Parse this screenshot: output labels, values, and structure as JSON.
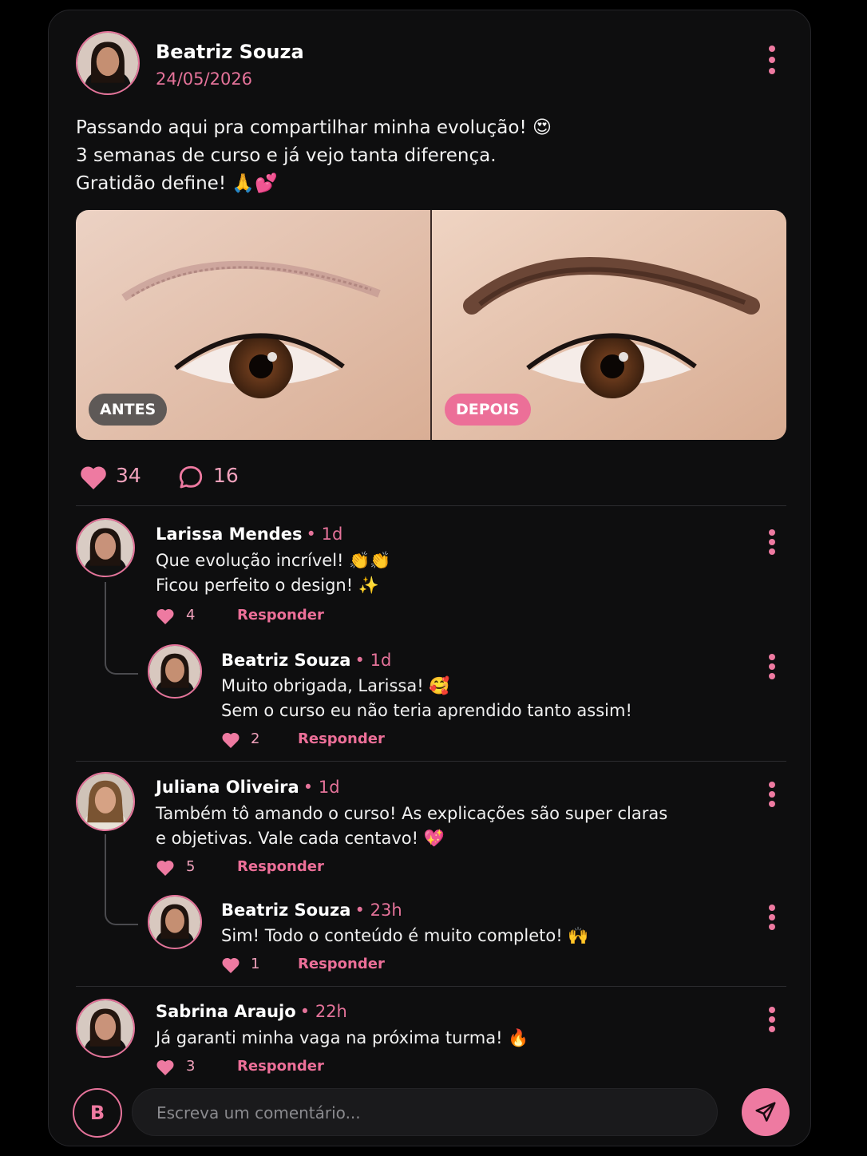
{
  "post": {
    "author": "Beatriz Souza",
    "date": "24/05/2026",
    "lines": [
      "Passando aqui pra compartilhar minha evolução! 😍",
      "3 semanas de curso e já vejo tanta diferença.",
      "Gratidão define! 🙏💕"
    ],
    "before_label": "ANTES",
    "after_label": "DEPOIS",
    "likes": "34",
    "comments": "16"
  },
  "comments": [
    {
      "name": "Larissa Mendes",
      "time": "1d",
      "lines": [
        "Que evolução incrível! 👏👏",
        "Ficou perfeito o design! ✨"
      ],
      "likes": "4",
      "reply_label": "Responder"
    },
    {
      "name": "Beatriz Souza",
      "time": "1d",
      "lines": [
        "Muito obrigada, Larissa! 🥰",
        "Sem o curso eu não teria aprendido tanto assim!"
      ],
      "likes": "2",
      "reply_label": "Responder"
    },
    {
      "name": "Juliana Oliveira",
      "time": "1d",
      "lines": [
        "Também tô amando o curso! As explicações são super claras",
        "e objetivas. Vale cada centavo! 💖"
      ],
      "likes": "5",
      "reply_label": "Responder"
    },
    {
      "name": "Beatriz Souza",
      "time": "23h",
      "lines": [
        "Sim! Todo o conteúdo é muito completo! 🙌"
      ],
      "likes": "1",
      "reply_label": "Responder"
    },
    {
      "name": "Sabrina Araujo",
      "time": "22h",
      "lines": [
        "Já garanti minha vaga na próxima turma! 🔥"
      ],
      "likes": "3",
      "reply_label": "Responder"
    }
  ],
  "composer": {
    "avatar_letter": "B",
    "placeholder": "Escreva um comentário..."
  },
  "colors": {
    "accent": "#ee7aa1",
    "background": "#0e0e0f"
  },
  "icons": [
    "heart-icon",
    "comment-icon",
    "more-vertical-icon",
    "send-icon"
  ]
}
